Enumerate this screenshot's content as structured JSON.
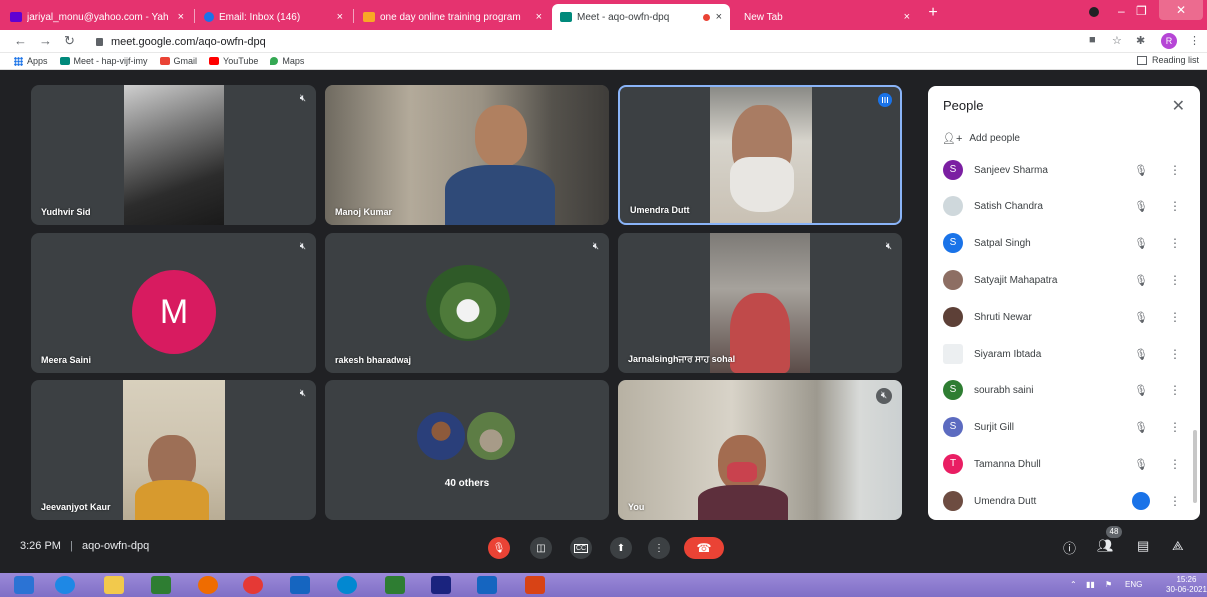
{
  "browser": {
    "tabs": [
      {
        "title": "jariyal_monu@yahoo.com - Yah",
        "close": "×",
        "favicon_color": "#6001d2"
      },
      {
        "title": "Email: Inbox (146)",
        "close": "×",
        "favicon_color": "#1a73e8"
      },
      {
        "title": "one day online training program",
        "close": "×",
        "favicon_color": "#f9a825"
      },
      {
        "title": "Meet - aqo-owfn-dpq",
        "close": "×",
        "favicon_color": "#00897b"
      },
      {
        "title": "New Tab",
        "close": "×",
        "favicon_color": "#ffffff"
      }
    ],
    "new_tab_symbol": "+",
    "url": "meet.google.com/aqo-owfn-dpq",
    "profile_initial": "R",
    "bookmarks": [
      {
        "label": "Apps",
        "color": "#1a73e8"
      },
      {
        "label": "Meet - hap-vijf-imy",
        "color": "#00897b"
      },
      {
        "label": "Gmail",
        "color": "#ea4335"
      },
      {
        "label": "YouTube",
        "color": "#ff0000"
      },
      {
        "label": "Maps",
        "color": "#34a853"
      }
    ],
    "reading_list": "Reading list"
  },
  "meeting": {
    "tiles": [
      {
        "name": "Yudhvir Sid",
        "muted": true
      },
      {
        "name": "Manoj Kumar",
        "muted": false
      },
      {
        "name": "Umendra Dutt",
        "speaking": true
      },
      {
        "name": "Meera Saini",
        "muted": true,
        "avatar_letter": "M"
      },
      {
        "name": "rakesh bharadwaj",
        "muted": true
      },
      {
        "name": "Jarnalsinghਜਾਰ ਸਾਹ sohal",
        "muted": true
      },
      {
        "name": "Jeevanjyot Kaur",
        "muted": true
      },
      {
        "name": "40 others"
      },
      {
        "name": "You",
        "muted": true
      }
    ],
    "time": "3:26 PM",
    "separator": "|",
    "code": "aqo-owfn-dpq",
    "participant_count": "48"
  },
  "people_panel": {
    "title": "People",
    "add_people": "Add people",
    "participants": [
      {
        "name": "Sanjeev Sharma",
        "initial": "S",
        "color": "#7b1fa2"
      },
      {
        "name": "Satish Chandra",
        "initial": "",
        "color": "#cfd8dc"
      },
      {
        "name": "Satpal Singh",
        "initial": "S",
        "color": "#1a73e8"
      },
      {
        "name": "Satyajit Mahapatra",
        "initial": "",
        "color": "#8d6e63"
      },
      {
        "name": "Shruti Newar",
        "initial": "",
        "color": "#5d4037"
      },
      {
        "name": "Siyaram Ibtada",
        "initial": "",
        "color": "#eceff1"
      },
      {
        "name": "sourabh saini",
        "initial": "S",
        "color": "#2e7d32"
      },
      {
        "name": "Surjit Gill",
        "initial": "S",
        "color": "#5c6bc0"
      },
      {
        "name": "Tamanna Dhull",
        "initial": "T",
        "color": "#e91e63"
      },
      {
        "name": "Umendra Dutt",
        "initial": "",
        "color": "#6d4c41",
        "speaking": true
      }
    ]
  },
  "taskbar": {
    "lang": "ENG",
    "time": "15:26",
    "date": "30-06-2021"
  }
}
